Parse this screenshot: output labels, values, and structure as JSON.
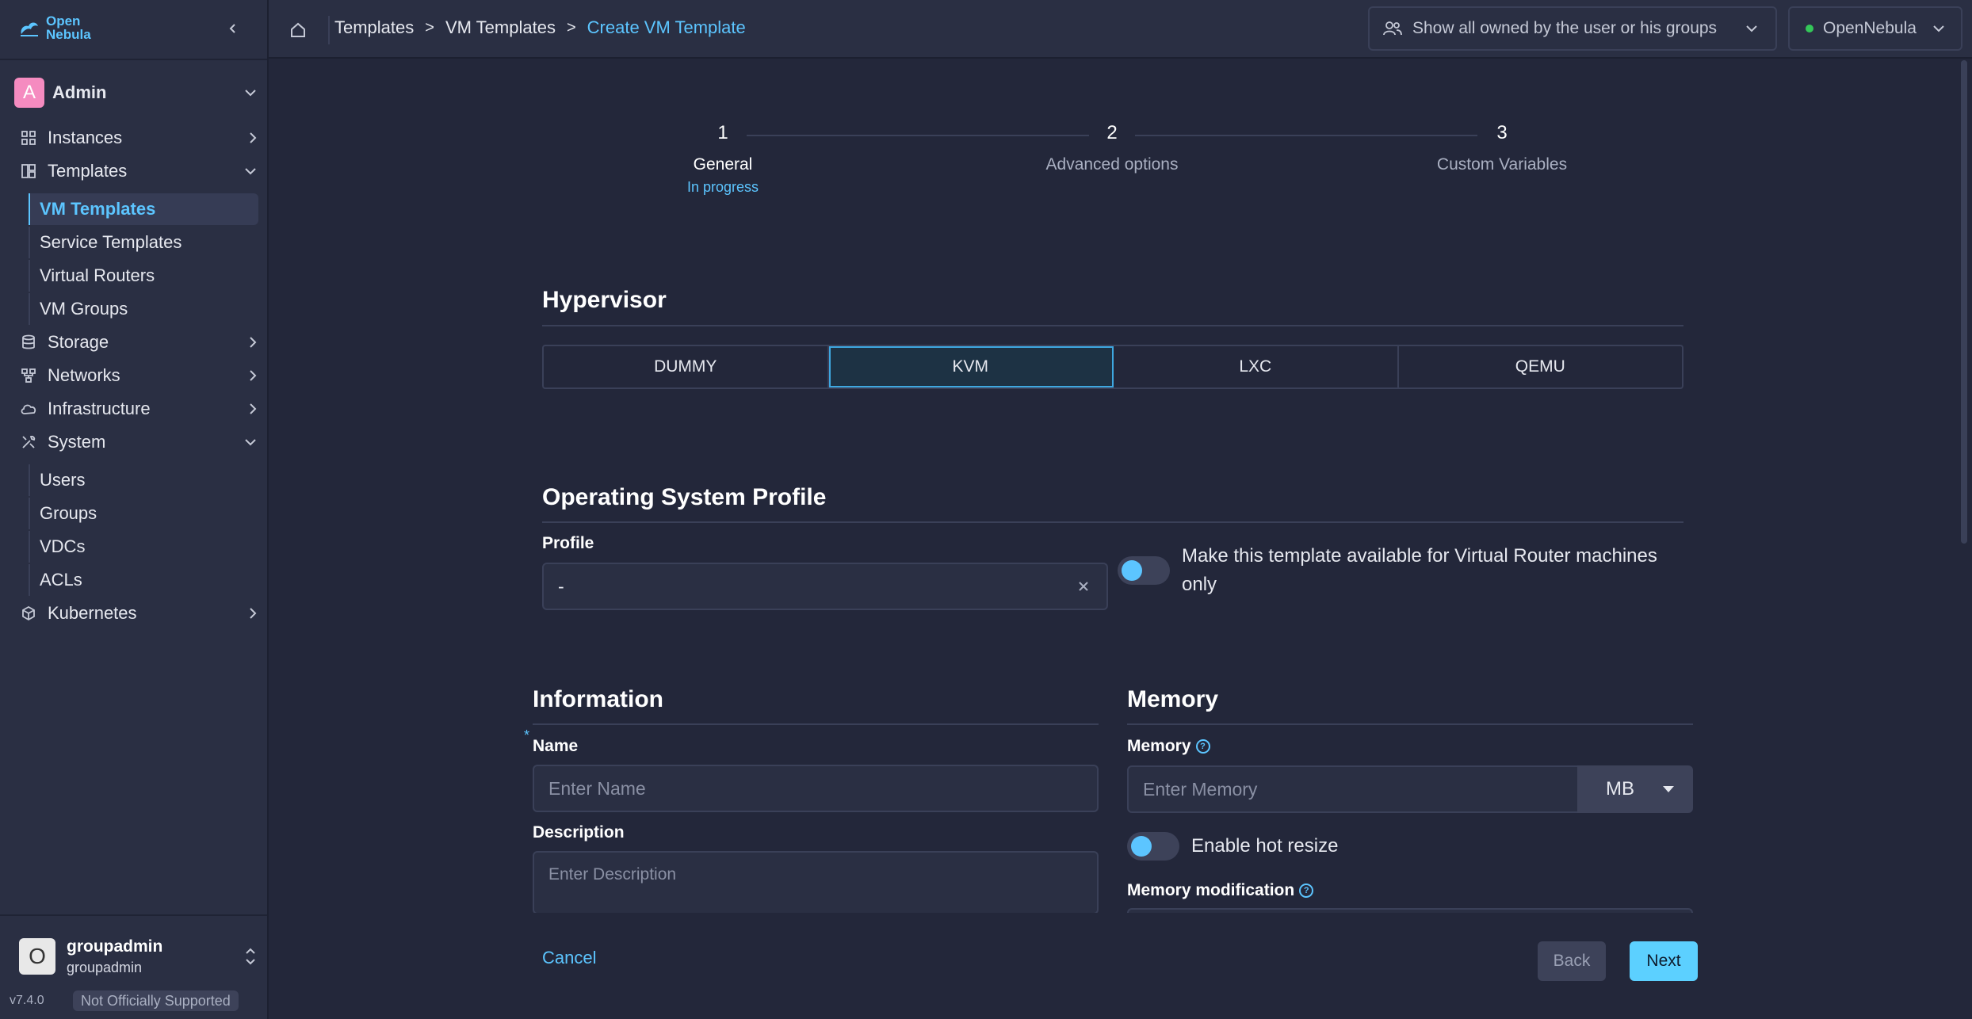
{
  "app": {
    "logo_line1": "Open",
    "logo_line2": "Nebula",
    "version": "v7.4.0",
    "support_badge": "Not Officially Supported"
  },
  "sidebar": {
    "group_user": "Admin",
    "items": {
      "instances": "Instances",
      "templates": "Templates",
      "vm_templates": "VM Templates",
      "service_templates": "Service Templates",
      "virtual_routers": "Virtual Routers",
      "vm_groups": "VM Groups",
      "storage": "Storage",
      "networks": "Networks",
      "infrastructure": "Infrastructure",
      "system": "System",
      "users": "Users",
      "groups": "Groups",
      "vdcs": "VDCs",
      "acls": "ACLs",
      "kubernetes": "Kubernetes"
    },
    "bottom_user": {
      "name": "groupadmin",
      "group": "groupadmin",
      "avatar_letter": "O"
    }
  },
  "topbar": {
    "breadcrumb": [
      "Templates",
      "VM Templates",
      "Create VM Template"
    ],
    "filter_label": "Show all owned by the user or his groups",
    "zone_label": "OpenNebula",
    "zone_status_color": "#34c759"
  },
  "stepper": [
    {
      "num": "1",
      "title": "General",
      "status": "In progress"
    },
    {
      "num": "2",
      "title": "Advanced options",
      "status": ""
    },
    {
      "num": "3",
      "title": "Custom Variables",
      "status": ""
    }
  ],
  "hypervisor": {
    "title": "Hypervisor",
    "options": [
      "DUMMY",
      "KVM",
      "LXC",
      "QEMU"
    ],
    "selected": "KVM"
  },
  "os_profile": {
    "title": "Operating System Profile",
    "profile_label": "Profile",
    "profile_value": "-",
    "vr_toggle_label": "Make this template available for Virtual Router machines only"
  },
  "information": {
    "title": "Information",
    "required_mark": "*",
    "name_label": "Name",
    "name_placeholder": "Enter Name",
    "description_label": "Description",
    "description_placeholder": "Enter Description"
  },
  "memory": {
    "title": "Memory",
    "memory_label": "Memory",
    "memory_placeholder": "Enter Memory",
    "unit": "MB",
    "hot_resize_label": "Enable hot resize",
    "modification_label": "Memory modification"
  },
  "footer": {
    "cancel": "Cancel",
    "back": "Back",
    "next": "Next"
  },
  "colors": {
    "accent": "#5cc5ff",
    "background": "#23273a",
    "panel": "#2a2f43"
  }
}
